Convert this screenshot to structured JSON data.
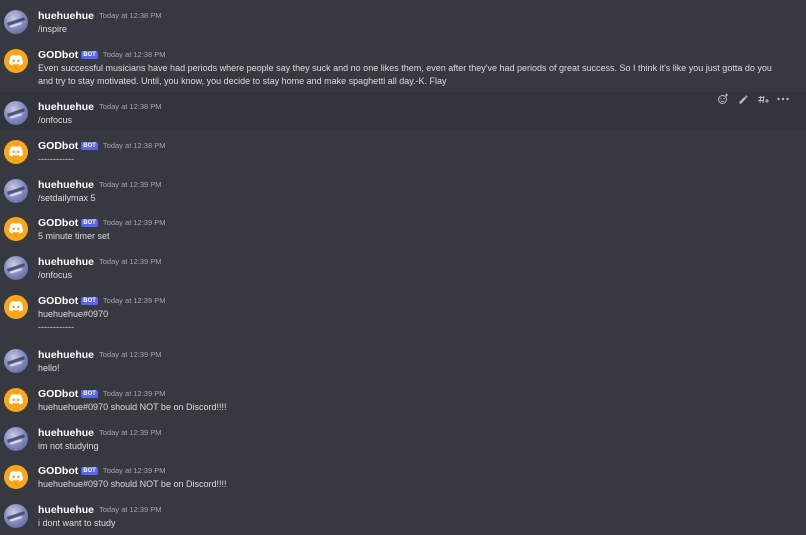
{
  "colors": {
    "background": "#36393f",
    "hover_background": "#32353b",
    "bot_tag": "#5865f2",
    "bot_avatar": "#faa61a",
    "text": "#dcddde",
    "timestamp": "#a3a6aa"
  },
  "toolbar": {
    "icons": [
      "add-reaction-icon",
      "edit-icon",
      "create-thread-icon",
      "more-icon"
    ]
  },
  "messages": [
    {
      "author": "huehuehue",
      "bot": false,
      "time": "Today at 12:38 PM",
      "text": "/inspire"
    },
    {
      "author": "GODbot",
      "bot": true,
      "tag": "BOT",
      "time": "Today at 12:38 PM",
      "text": "Even successful musicians have had periods where people say they suck and no one likes them, even after they've had periods of great success. So I think it's like you just gotta do you and try to stay motivated. Until, you know, you decide to stay home and make spaghetti all day.-K. Flay"
    },
    {
      "author": "huehuehue",
      "bot": false,
      "time": "Today at 12:38 PM",
      "text": "/onfocus"
    },
    {
      "author": "GODbot",
      "bot": true,
      "tag": "BOT",
      "time": "Today at 12:38 PM",
      "text": "------------"
    },
    {
      "author": "huehuehue",
      "bot": false,
      "time": "Today at 12:39 PM",
      "text": "/setdailymax 5"
    },
    {
      "author": "GODbot",
      "bot": true,
      "tag": "BOT",
      "time": "Today at 12:39 PM",
      "text": "5 minute timer set"
    },
    {
      "author": "huehuehue",
      "bot": false,
      "time": "Today at 12:39 PM",
      "text": "/onfocus"
    },
    {
      "author": "GODbot",
      "bot": true,
      "tag": "BOT",
      "time": "Today at 12:39 PM",
      "text": "huehuehue#0970\n------------"
    },
    {
      "author": "huehuehue",
      "bot": false,
      "time": "Today at 12:39 PM",
      "text": "hello!"
    },
    {
      "author": "GODbot",
      "bot": true,
      "tag": "BOT",
      "time": "Today at 12:39 PM",
      "text": "huehuehue#0970 should NOT be on Discord!!!!"
    },
    {
      "author": "huehuehue",
      "bot": false,
      "time": "Today at 12:39 PM",
      "text": "im not studying"
    },
    {
      "author": "GODbot",
      "bot": true,
      "tag": "BOT",
      "time": "Today at 12:39 PM",
      "text": "huehuehue#0970 should NOT be on Discord!!!!"
    },
    {
      "author": "huehuehue",
      "bot": false,
      "time": "Today at 12:39 PM",
      "text": "i dont want to study"
    }
  ]
}
